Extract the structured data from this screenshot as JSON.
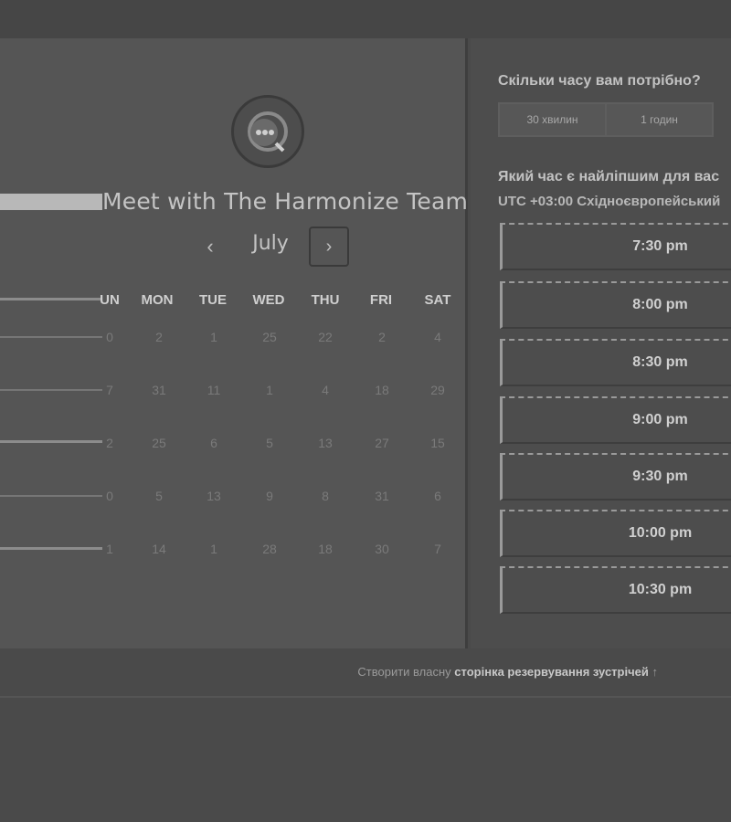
{
  "calendar": {
    "title": "Meet with The Harmonize Team",
    "month": "July",
    "prev_symbol": "‹",
    "next_symbol": "›",
    "weekdays": [
      "UN",
      "MON",
      "TUE",
      "WED",
      "THU",
      "FRI",
      "SAT"
    ],
    "weeks": [
      [
        "0",
        "2",
        "1",
        "25",
        "22",
        "2",
        "4"
      ],
      [
        "7",
        "31",
        "11",
        "1",
        "4",
        "18",
        "29"
      ],
      [
        "2",
        "25",
        "6",
        "5",
        "13",
        "27",
        "15"
      ],
      [
        "0",
        "5",
        "13",
        "9",
        "8",
        "31",
        "6"
      ],
      [
        "1",
        "14",
        "1",
        "28",
        "18",
        "30",
        "7"
      ]
    ]
  },
  "booking": {
    "duration_question": "Скільки часу вам потрібно?",
    "durations": [
      "30 хвилин",
      "1 годин"
    ],
    "time_question": "Який час є найліпшим для вас",
    "timezone": "UTC +03:00 Східноєвропейський",
    "slots": [
      "7:30 pm",
      "8:00 pm",
      "8:30 pm",
      "9:00 pm",
      "9:30 pm",
      "10:00 pm",
      "10:30 pm"
    ]
  },
  "footer": {
    "prefix": "Створити власну",
    "link": "сторінка резервування зустрічей",
    "arrow": "↑"
  }
}
